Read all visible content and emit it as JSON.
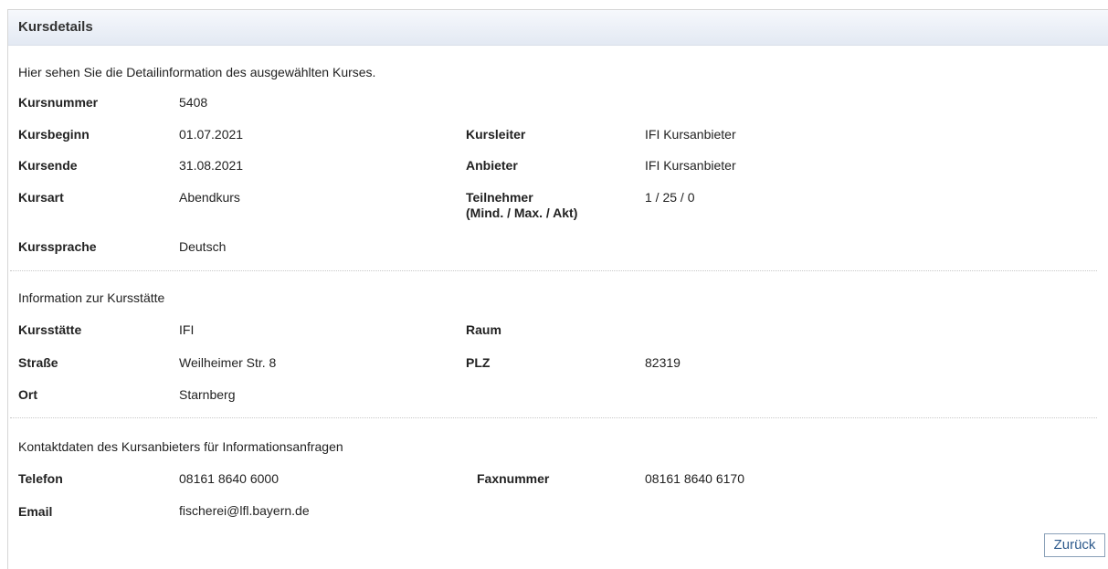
{
  "header": {
    "title": "Kursdetails"
  },
  "intro": "Hier sehen Sie die Detailinformation des ausgewählten Kurses.",
  "course": {
    "kursnummer": {
      "label": "Kursnummer",
      "value": "5408"
    },
    "kursbeginn": {
      "label": "Kursbeginn",
      "value": "01.07.2021"
    },
    "kursleiter": {
      "label": "Kursleiter",
      "value": "IFI Kursanbieter"
    },
    "kursende": {
      "label": "Kursende",
      "value": "31.08.2021"
    },
    "anbieter": {
      "label": "Anbieter",
      "value": "IFI Kursanbieter"
    },
    "kursart": {
      "label": "Kursart",
      "value": "Abendkurs"
    },
    "teilnehmer": {
      "label": "Teilnehmer",
      "sublabel": "(Mind. / Max. / Akt)",
      "value": "1 / 25 / 0"
    },
    "kurssprache": {
      "label": "Kurssprache",
      "value": "Deutsch"
    }
  },
  "venue": {
    "heading": "Information zur Kursstätte",
    "kursstaette": {
      "label": "Kursstätte",
      "value": "IFI"
    },
    "raum": {
      "label": "Raum",
      "value": ""
    },
    "strasse": {
      "label": "Straße",
      "value": "Weilheimer Str. 8"
    },
    "plz": {
      "label": "PLZ",
      "value": "82319"
    },
    "ort": {
      "label": "Ort",
      "value": "Starnberg"
    }
  },
  "contact": {
    "heading": "Kontaktdaten des Kursanbieters für Informationsanfragen",
    "telefon": {
      "label": "Telefon",
      "value": "08161 8640 6000"
    },
    "fax": {
      "label": "Faxnummer",
      "value": "08161 8640 6170"
    },
    "email": {
      "label": "Email",
      "value": "fischerei@lfl.bayern.de"
    }
  },
  "actions": {
    "back_label": "Zurück"
  }
}
